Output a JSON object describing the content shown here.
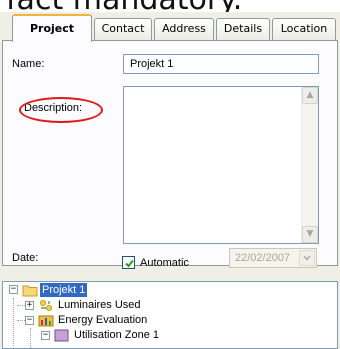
{
  "caption": "fact mandatory.",
  "tabs": [
    {
      "label": "Project"
    },
    {
      "label": "Contact"
    },
    {
      "label": "Address"
    },
    {
      "label": "Details"
    },
    {
      "label": "Location"
    }
  ],
  "form": {
    "name_label": "Name:",
    "name_value": "Projekt 1",
    "description_label": "Description:",
    "description_value": "",
    "date_label": "Date:",
    "automatic_label": "Automatic",
    "automatic_checked": true,
    "date_value": "22/02/2007"
  },
  "tree": {
    "items": [
      {
        "label": "Projekt 1",
        "icon": "folder-icon",
        "selected": true
      },
      {
        "label": "Luminaires Used",
        "icon": "luminaire-icon"
      },
      {
        "label": "Energy Evaluation",
        "icon": "energy-icon"
      },
      {
        "label": "Utilisation Zone 1",
        "icon": "zone-icon"
      }
    ]
  },
  "colors": {
    "active_tab_accent": "#f4b13c",
    "highlight_circle": "#e01818",
    "selection": "#316ac5"
  }
}
